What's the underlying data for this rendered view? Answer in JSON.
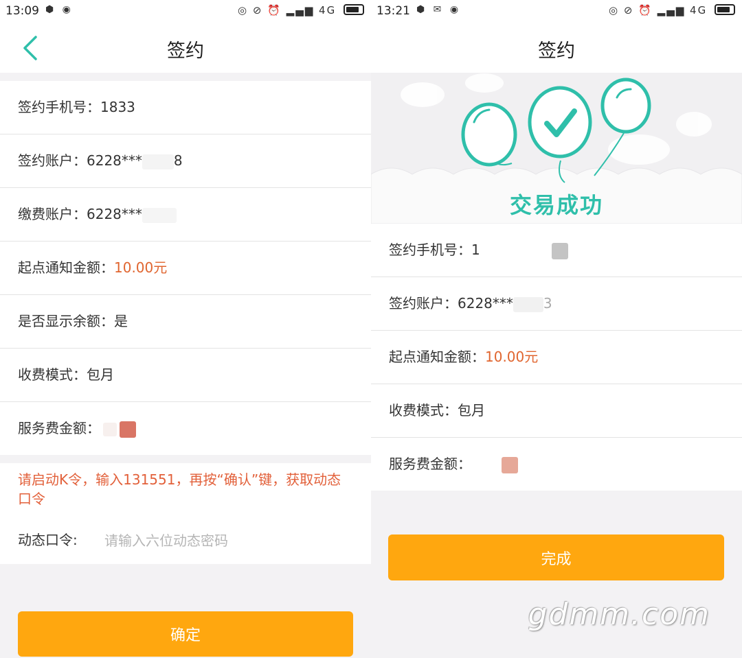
{
  "left": {
    "status": {
      "time": "13:09",
      "network": "4G"
    },
    "title": "签约",
    "rows": [
      {
        "label": "签约手机号：",
        "value": "1833"
      },
      {
        "label": "签约账户：",
        "value": "6228***",
        "tail": "8"
      },
      {
        "label": "缴费账户：",
        "value": "6228***"
      },
      {
        "label": "起点通知金额：",
        "value": "10.00元"
      },
      {
        "label": "是否显示余额：",
        "value": "是"
      },
      {
        "label": "收费模式：",
        "value": "包月"
      },
      {
        "label": "服务费金额：",
        "value": ""
      }
    ],
    "notice": "请启动K令，输入131551，再按“确认”键，获取动态口令",
    "otp_label": "动态口令:",
    "otp_placeholder": "请输入六位动态密码",
    "confirm_button": "确定"
  },
  "right": {
    "status": {
      "time": "13:21",
      "network": "4G"
    },
    "title": "签约",
    "success_text": "交易成功",
    "rows": [
      {
        "label": "签约手机号：",
        "value": "1"
      },
      {
        "label": "签约账户：",
        "value": "6228***",
        "tail": "3"
      },
      {
        "label": "起点通知金额：",
        "value": "10.00元"
      },
      {
        "label": "收费模式：",
        "value": "包月"
      },
      {
        "label": "服务费金额：",
        "value": ""
      }
    ],
    "done_button": "完成"
  },
  "watermark": "gdmm.com",
  "colors": {
    "accent_orange": "#ffa70f",
    "amount_orange": "#e0652f",
    "teal": "#2fbfaa"
  },
  "icons": [
    "back-arrow-icon",
    "balloon-check-icon",
    "battery-icon",
    "signal-icon",
    "alarm-icon"
  ]
}
